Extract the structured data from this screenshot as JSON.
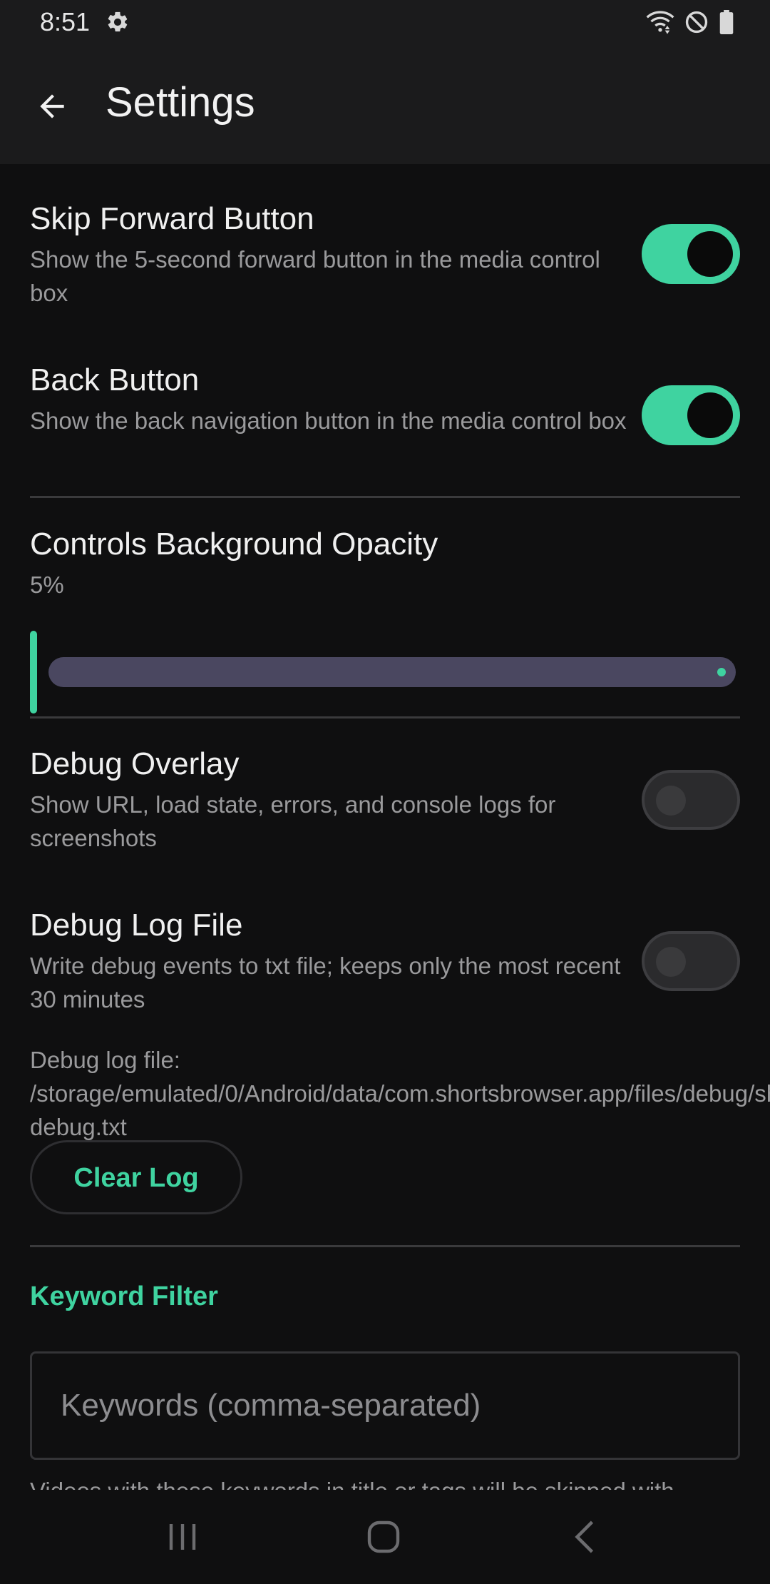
{
  "status_bar": {
    "time": "8:51",
    "left_icons": [
      "gear-icon"
    ],
    "right_icons": [
      "wifi-icon",
      "do-not-disturb-icon",
      "battery-icon"
    ]
  },
  "app_bar": {
    "title": "Settings",
    "back_icon": "arrow-left-icon"
  },
  "settings": {
    "skip_forward": {
      "title": "Skip Forward Button",
      "description": "Show the 5-second forward button in the media control box",
      "enabled": true
    },
    "back_button": {
      "title": "Back Button",
      "description": "Show the back navigation button in the media control box",
      "enabled": true
    },
    "opacity": {
      "title": "Controls Background Opacity",
      "value_label": "5%",
      "value_percent": 5
    },
    "debug_overlay": {
      "title": "Debug Overlay",
      "description": "Show URL, load state, errors, and console logs for screenshots",
      "enabled": false
    },
    "debug_log_file": {
      "title": "Debug Log File",
      "description": "Write debug events to txt file; keeps only the most recent 30 minutes",
      "enabled": false
    },
    "log_path": "Debug log file: /storage/emulated/0/Android/data/com.shortsbrowser.app/files/debug/shortsbro-debug.txt",
    "clear_log_label": "Clear Log"
  },
  "keyword_filter": {
    "header": "Keyword Filter",
    "placeholder": "Keywords (comma-separated)",
    "value": "",
    "help_text": "Videos with these keywords in title or tags will be skipped with"
  },
  "nav_bar": {
    "icons": [
      "recent-apps-icon",
      "home-icon",
      "back-nav-icon"
    ]
  },
  "colors": {
    "accent": "#3fd3a0",
    "background": "#0f0f10",
    "app_bar": "#1b1b1c",
    "slider_track": "#4a4760"
  }
}
